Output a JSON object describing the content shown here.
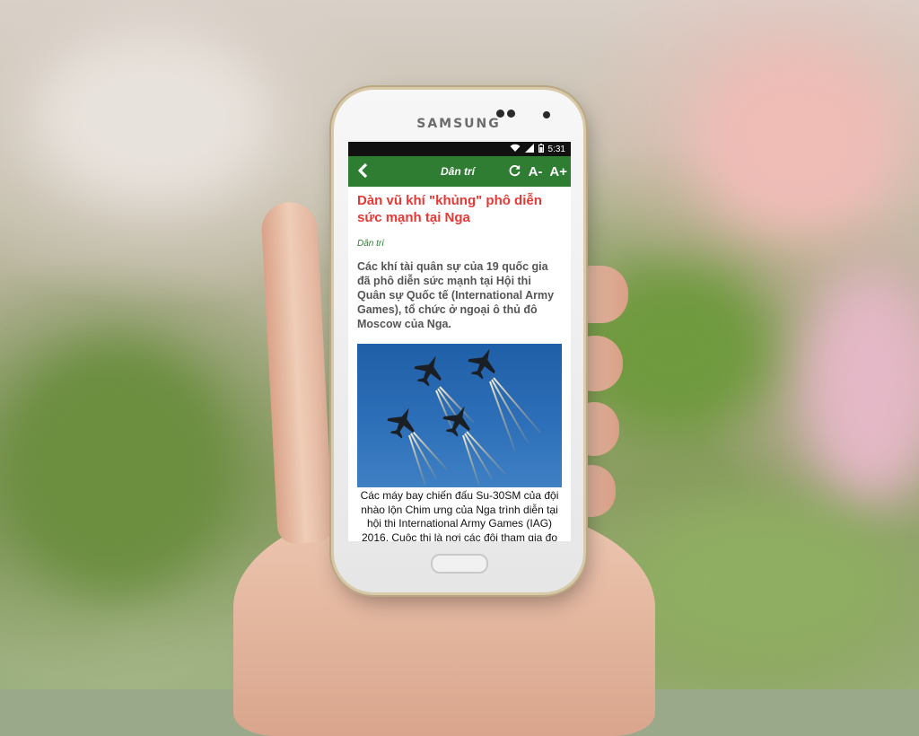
{
  "device": {
    "brand": "SAMSUNG"
  },
  "status_bar": {
    "time": "5:31",
    "wifi_icon": "wifi-icon",
    "signal_icon": "signal-icon",
    "battery_icon": "battery-icon"
  },
  "app_bar": {
    "back_icon": "chevron-left-icon",
    "title": "Dân trí",
    "refresh_icon": "refresh-icon",
    "font_decrease": "A-",
    "font_increase": "A+",
    "color": "#2e7d32"
  },
  "article": {
    "headline": "Dàn vũ khí \"khủng\" phô diễn sức mạnh tại Nga",
    "headline_color": "#e53935",
    "source": "Dân trí",
    "lead": "Các khí tài quân sự của 19 quốc gia đã phô diễn sức mạnh tại Hội thi Quân sự Quốc tế (International Army Games), tổ chức ở ngoại ô thủ đô Moscow của Nga.",
    "image_icon": "jet-aircraft-photo",
    "caption": "Các máy bay chiến đấu Su-30SM của đội nhào lộn Chim ưng của Nga trình diễn tại hội thi International Army Games (IAG) 2016. Cuộc thi là nơi các đội tham gia đọ sức về kỹ năng chuyên nghiệp trên các lĩnh vực quân sự."
  }
}
